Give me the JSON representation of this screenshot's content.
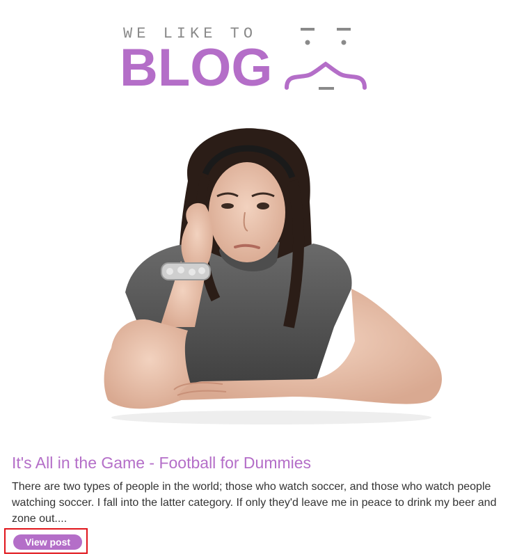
{
  "logo": {
    "tagline": "WE LIKE TO",
    "word": "BLOG"
  },
  "post": {
    "title": "It's All in the Game - Football for Dummies",
    "excerpt": "There are two types of people in the world; those who watch soccer, and those who watch people watching soccer. I fall into the latter category. If only they'd leave me in peace to drink my beer and zone out....",
    "button_label": "View post"
  },
  "colors": {
    "brand": "#b46ec8",
    "text": "#333333",
    "tagline": "#8a8a8a",
    "highlight": "#e0151b"
  }
}
